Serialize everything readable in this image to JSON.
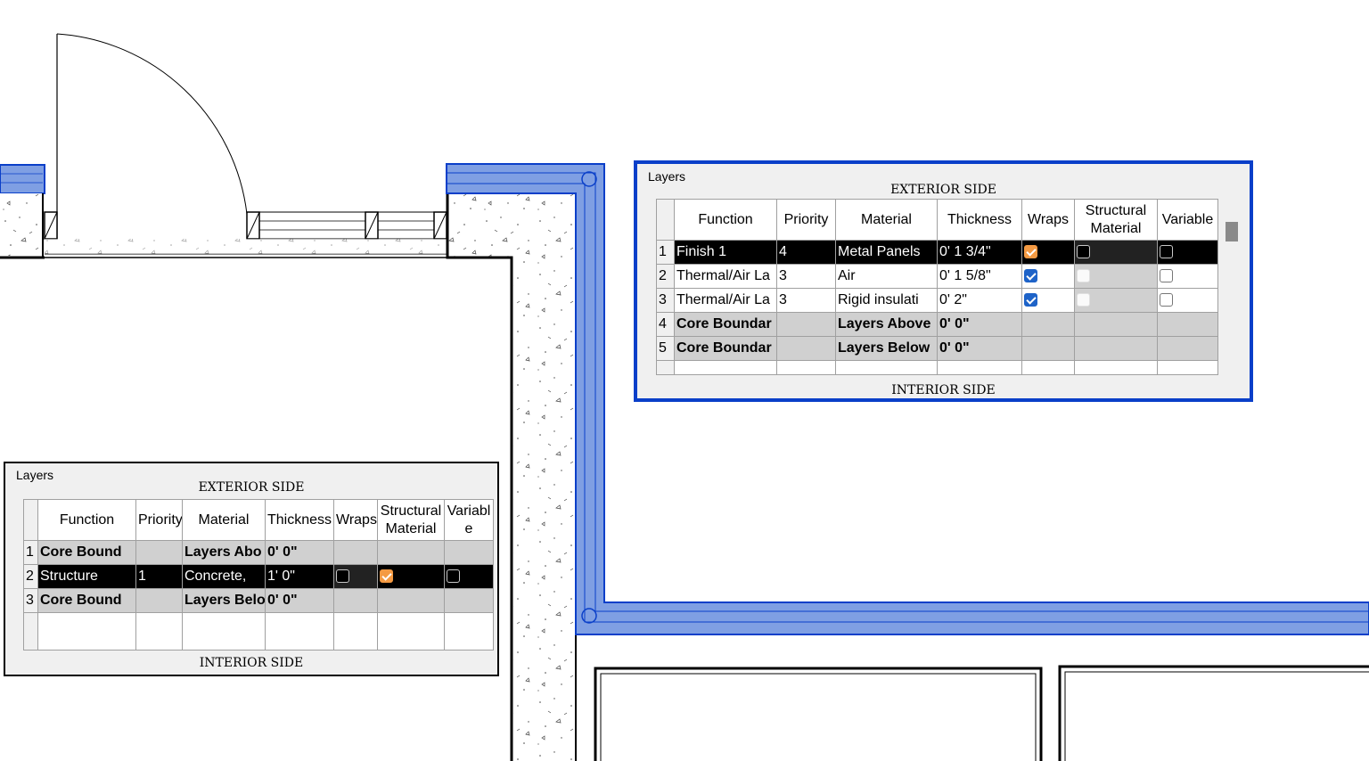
{
  "large_panel": {
    "title": "Layers",
    "exterior_label": "EXTERIOR SIDE",
    "interior_label": "INTERIOR SIDE",
    "headers": {
      "function": "Function",
      "priority": "Priority",
      "material": "Material",
      "thickness": "Thickness",
      "wraps": "Wraps",
      "structural_material": "Structural Material",
      "variable": "Variable"
    },
    "rows": [
      {
        "num": "1",
        "function": "Finish 1",
        "priority": "4",
        "material": "Metal Panels",
        "thickness": "0'  1 3/4\""
      },
      {
        "num": "2",
        "function": "Thermal/Air La",
        "priority": "3",
        "material": "Air",
        "thickness": "0'  1 5/8\""
      },
      {
        "num": "3",
        "function": "Thermal/Air La",
        "priority": "3",
        "material": "Rigid insulati",
        "thickness": "0'  2\""
      },
      {
        "num": "4",
        "function": "Core Boundar",
        "priority": "",
        "material": "Layers Above",
        "thickness": "0'  0\""
      },
      {
        "num": "5",
        "function": "Core Boundar",
        "priority": "",
        "material": "Layers Below",
        "thickness": "0'  0\""
      }
    ]
  },
  "small_panel": {
    "title": "Layers",
    "exterior_label": "EXTERIOR SIDE",
    "interior_label": "INTERIOR SIDE",
    "headers": {
      "function": "Function",
      "priority": "Priority",
      "material": "Material",
      "thickness": "Thickness",
      "wraps": "Wraps",
      "structural_material": "Structural Material",
      "variable": "Variabl e"
    },
    "rows": [
      {
        "num": "1",
        "function": "Core Bound",
        "priority": "",
        "material": "Layers Abo",
        "thickness": "0'  0\""
      },
      {
        "num": "2",
        "function": "Structure",
        "priority": "1",
        "material": "Concrete,",
        "thickness": "1'  0\""
      },
      {
        "num": "3",
        "function": "Core Bound",
        "priority": "",
        "material": "Layers Belo",
        "thickness": "0'  0\""
      }
    ]
  },
  "colors": {
    "wall_highlight": "#7f9fe3",
    "wall_outline": "#0a3fc9",
    "panel_border_large": "#0a3fc9",
    "checkbox_blue": "#1e63c8",
    "checkbox_orange": "#f49a43",
    "selected_row": "#000000"
  }
}
